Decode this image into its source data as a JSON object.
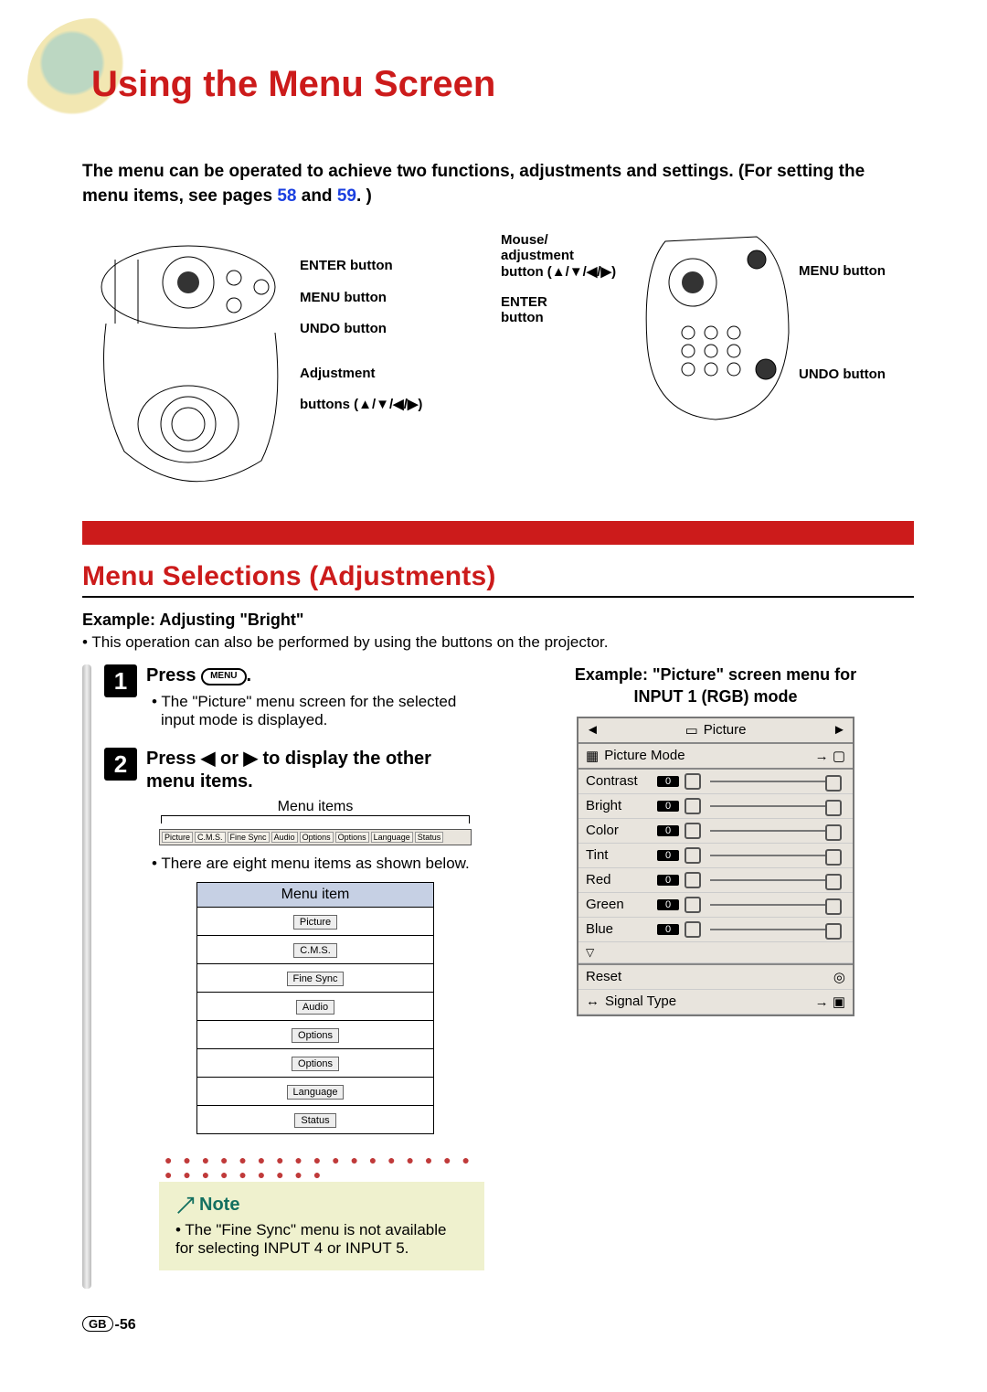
{
  "page_title": "Using the Menu Screen",
  "intro": {
    "text_a": "The menu can be operated to achieve two functions, adjustments and settings. (For setting the menu items, see pages ",
    "link1": "58",
    "and": " and ",
    "link2": "59",
    "text_b": ". )"
  },
  "labels_projector": {
    "enter": "ENTER button",
    "menu": "MENU button",
    "undo": "UNDO button",
    "adjust_a": "Adjustment",
    "adjust_b": "buttons (▲/▼/◀/▶)"
  },
  "labels_remote": {
    "mouse_a": "Mouse/",
    "mouse_b": "adjustment",
    "mouse_c": "button (▲/▼/◀/▶)",
    "enter_a": "ENTER",
    "enter_b": "button",
    "menu": "MENU button",
    "undo": "UNDO button"
  },
  "section_title": "Menu Selections (Adjustments)",
  "example_label": "Example: Adjusting \"Bright\"",
  "example_sub": "• This operation can also be performed by using the buttons on the projector.",
  "step1": {
    "num": "1",
    "title_a": "Press ",
    "key": "MENU",
    "title_b": ".",
    "desc": "• The \"Picture\" menu screen for the selected input mode is displayed."
  },
  "step2": {
    "num": "2",
    "title": "Press ◀ or ▶ to display the other menu items.",
    "strip_label": "Menu items",
    "strip_items": [
      "Picture",
      "C.M.S.",
      "Fine Sync",
      "Audio",
      "Options",
      "Options",
      "Language",
      "Status"
    ],
    "desc": "• There are eight menu items as shown below.",
    "table_header": "Menu item",
    "table_items": [
      "Picture",
      "C.M.S.",
      "Fine Sync",
      "Audio",
      "Options",
      "Options",
      "Language",
      "Status"
    ]
  },
  "note": {
    "heading": "Note",
    "text": "• The \"Fine Sync\" menu is not available for selecting INPUT 4 or INPUT 5."
  },
  "osd": {
    "title_a": "Example: \"Picture\" screen menu for",
    "title_b": "INPUT 1 (RGB) mode",
    "head": "Picture",
    "picture_mode": "Picture Mode",
    "rows": [
      {
        "label": "Contrast",
        "val": "0"
      },
      {
        "label": "Bright",
        "val": "0"
      },
      {
        "label": "Color",
        "val": "0"
      },
      {
        "label": "Tint",
        "val": "0"
      },
      {
        "label": "Red",
        "val": "0"
      },
      {
        "label": "Green",
        "val": "0"
      },
      {
        "label": "Blue",
        "val": "0"
      }
    ],
    "reset": "Reset",
    "signal": "Signal Type"
  },
  "page_num_prefix": "GB",
  "page_num": "-56"
}
